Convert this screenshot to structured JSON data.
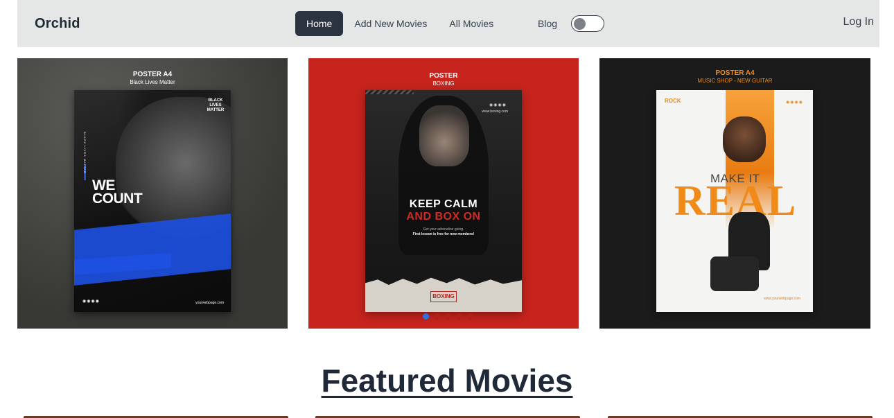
{
  "navbar": {
    "brand": "Orchid",
    "links": [
      {
        "label": "Home",
        "active": true
      },
      {
        "label": "Add New Movies",
        "active": false
      },
      {
        "label": "All Movies",
        "active": false
      }
    ],
    "blog_label": "Blog",
    "theme_toggle_on": false,
    "login_label": "Log In"
  },
  "carousel": {
    "slides": [
      {
        "title": "POSTER A4",
        "subtitle": "Black Lives Matter",
        "headline_line1": "WE",
        "headline_line2": "COUNT",
        "logo_text": "BLACK LIVES MATTER",
        "side_text": "BLACK LIVES MATTER",
        "url": "yourwebpage.com",
        "title_color": "#ffffff"
      },
      {
        "title": "POSTER",
        "subtitle": "BOXING",
        "headline_line1": "KEEP CALM",
        "headline_line2": "AND BOX ON",
        "tagline1": "Get your adrenaline going.",
        "tagline2": "First lesson is free for new members!",
        "badge": "BOXING",
        "url": "www.boxing.com",
        "title_color": "#ffffff"
      },
      {
        "title": "POSTER A4",
        "subtitle": "MUSIC SHOP - NEW GUITAR",
        "headline_line1": "MAKE IT",
        "headline_line2": "REAL",
        "logo_text": "ROCK",
        "url": "www.yourwebpage.com",
        "title_color": "#f08a19"
      }
    ],
    "indicator_count": 5,
    "active_index": 0,
    "colors": {
      "indicator_active": "#2a72e0",
      "indicator_inactive": "#b21f19"
    }
  },
  "section": {
    "title": "Featured Movies"
  },
  "colors": {
    "nav_bg": "#e5e7e7",
    "active_pill": "#2b3240",
    "text": "#1f2937",
    "poster_red": "#c6241d",
    "accent_blue": "#1d4fe0",
    "accent_orange": "#f08a19"
  }
}
